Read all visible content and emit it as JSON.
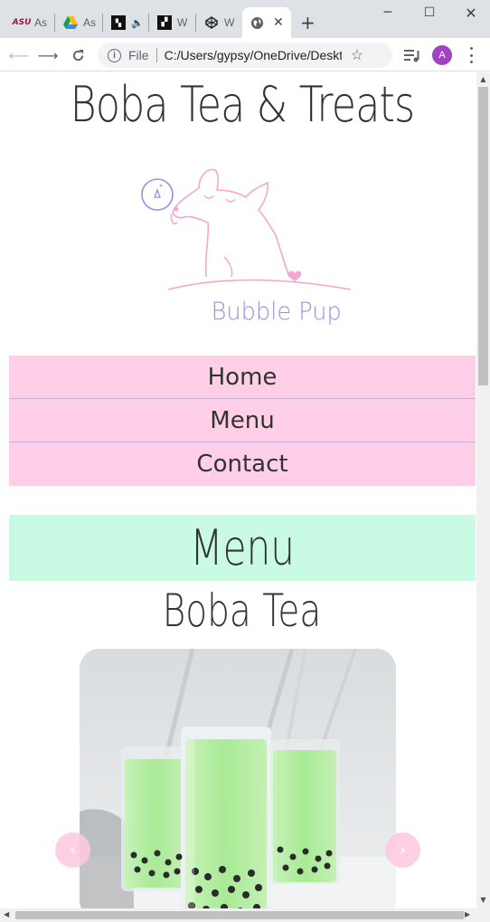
{
  "browser": {
    "tabs": [
      {
        "favicon": "asu-icon",
        "title": "As"
      },
      {
        "favicon": "google-drive-icon",
        "title": "As"
      },
      {
        "favicon": "app-icon",
        "title": "W"
      },
      {
        "favicon": "app-icon",
        "title": "W"
      },
      {
        "favicon": "codepen-icon",
        "title": "W"
      },
      {
        "favicon": "globe-icon",
        "title": "",
        "active": true
      }
    ],
    "scheme_label": "File",
    "url": "C:/Users/gypsy/OneDrive/Deskto...",
    "avatar_letter": "A"
  },
  "site": {
    "title": "Boba Tea & Treats",
    "logo_text": "Bubble Pup",
    "nav": [
      "Home",
      "Menu",
      "Contact"
    ],
    "menu_heading": "Menu",
    "section_heading": "Boba Tea",
    "carousel_prev": "‹",
    "carousel_next": "›"
  },
  "colors": {
    "nav_bg": "#ffcfe7",
    "menu_banner_bg": "#c9fae3",
    "logo_pink": "#f4a6d0",
    "logo_purple": "#9b8fe0",
    "drink_green": "#b6f0a8"
  }
}
